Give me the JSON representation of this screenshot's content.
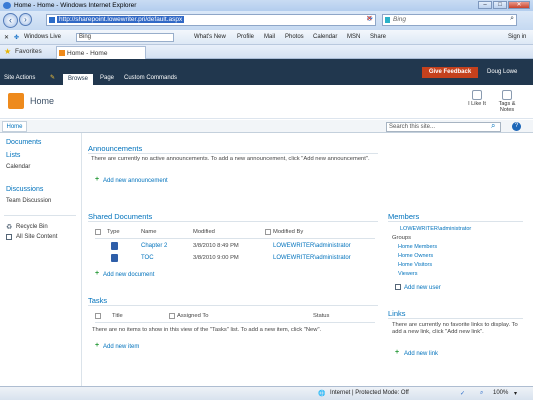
{
  "browser": {
    "window_title": "Home - Home - Windows Internet Explorer",
    "url": "http://sharepoint.lowewriter.pri/default.aspx",
    "search_placeholder": "Bing",
    "links_bar": {
      "windows_live": "Windows Live",
      "bing_value": "Bing",
      "items": [
        "What's New",
        "Profile",
        "Mail",
        "Photos",
        "Calendar",
        "MSN",
        "Share"
      ],
      "sign_in": "Sign in"
    },
    "favorites": "Favorites",
    "tab_title": "Home - Home",
    "status_zone": "Internet | Protected Mode: Off",
    "zoom": "100%"
  },
  "ribbon": {
    "site_actions": "Site Actions",
    "tabs": [
      "Browse",
      "Page",
      "Custom Commands"
    ],
    "feedback": "Give Feedback",
    "user": "Doug Lowe"
  },
  "site": {
    "title": "Home",
    "tools": [
      "I Like It",
      "Tags & Notes"
    ],
    "home_tab": "Home",
    "search_placeholder": "Search this site..."
  },
  "left_nav": {
    "documents": "Documents",
    "lists": "Lists",
    "calendar": "Calendar",
    "discussions": "Discussions",
    "team_discussion": "Team Discussion",
    "recycle_bin": "Recycle Bin",
    "all_site_content": "All Site Content"
  },
  "announcements": {
    "title": "Announcements",
    "empty": "There are currently no active announcements. To add a new announcement, click \"Add new announcement\".",
    "add": "Add new announcement"
  },
  "shared_documents": {
    "title": "Shared Documents",
    "columns": [
      "Type",
      "Name",
      "Modified",
      "Modified By"
    ],
    "rows": [
      {
        "name": "Chapter 2",
        "modified": "3/8/2010 8:49 PM",
        "by": "LOWEWRITER\\administrator"
      },
      {
        "name": "TOC",
        "modified": "3/8/2010 9:00 PM",
        "by": "LOWEWRITER\\administrator"
      }
    ],
    "add": "Add new document"
  },
  "tasks": {
    "title": "Tasks",
    "columns": [
      "Title",
      "Assigned To",
      "Status"
    ],
    "empty": "There are no items to show in this view of the \"Tasks\" list. To add a new item, click \"New\".",
    "add": "Add new item"
  },
  "members": {
    "title": "Members",
    "admin": "LOWEWRITER\\administrator",
    "groups_label": "Groups",
    "groups": [
      "Home Members",
      "Home Owners",
      "Home Visitors",
      "Viewers"
    ],
    "add": "Add new user"
  },
  "links": {
    "title": "Links",
    "empty": "There are currently no favorite links to display. To add a new link, click \"Add new link\".",
    "add": "Add new link"
  }
}
